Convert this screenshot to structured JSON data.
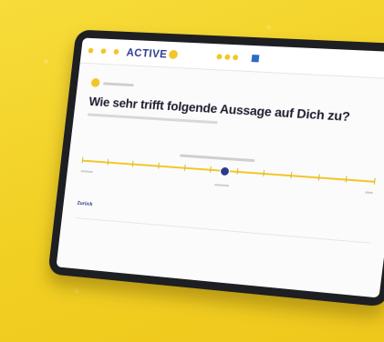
{
  "header": {
    "logo_text": "ACTIVE"
  },
  "main": {
    "question_title": "Wie sehr trifft folgende Aussage auf Dich zu?",
    "slider": {
      "ticks": 12,
      "value_fraction": 0.5
    },
    "back_label": "Zurück"
  }
}
